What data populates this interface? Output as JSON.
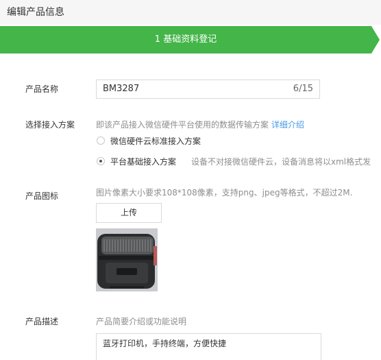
{
  "header": {
    "title": "编辑产品信息"
  },
  "step": {
    "label": "1 基础资料登记",
    "color": "#44b549"
  },
  "form": {
    "name": {
      "label": "产品名称",
      "value": "BM3287",
      "counter": "6/15"
    },
    "access": {
      "label": "选择接入方案",
      "hint": "即该产品接入微信硬件平台使用的数据传输方案",
      "link": "详细介绍",
      "options": [
        {
          "label": "微信硬件云标准接入方案",
          "checked": false
        },
        {
          "label": "平台基础接入方案",
          "checked": true,
          "desc": "设备不对接微信硬件云，设备消息将以xml格式发"
        }
      ]
    },
    "icon": {
      "label": "产品图标",
      "hint": "图片像素大小要求108*108像素，支持png、jpeg等格式，不超过2M.",
      "upload_label": "上传"
    },
    "description": {
      "label": "产品描述",
      "hint": "产品简要介绍或功能说明",
      "value": "蓝牙打印机，手持终端，方便快捷"
    }
  },
  "colors": {
    "accent": "#44b549",
    "link": "#459ae9",
    "hint": "#8d8d8d"
  }
}
